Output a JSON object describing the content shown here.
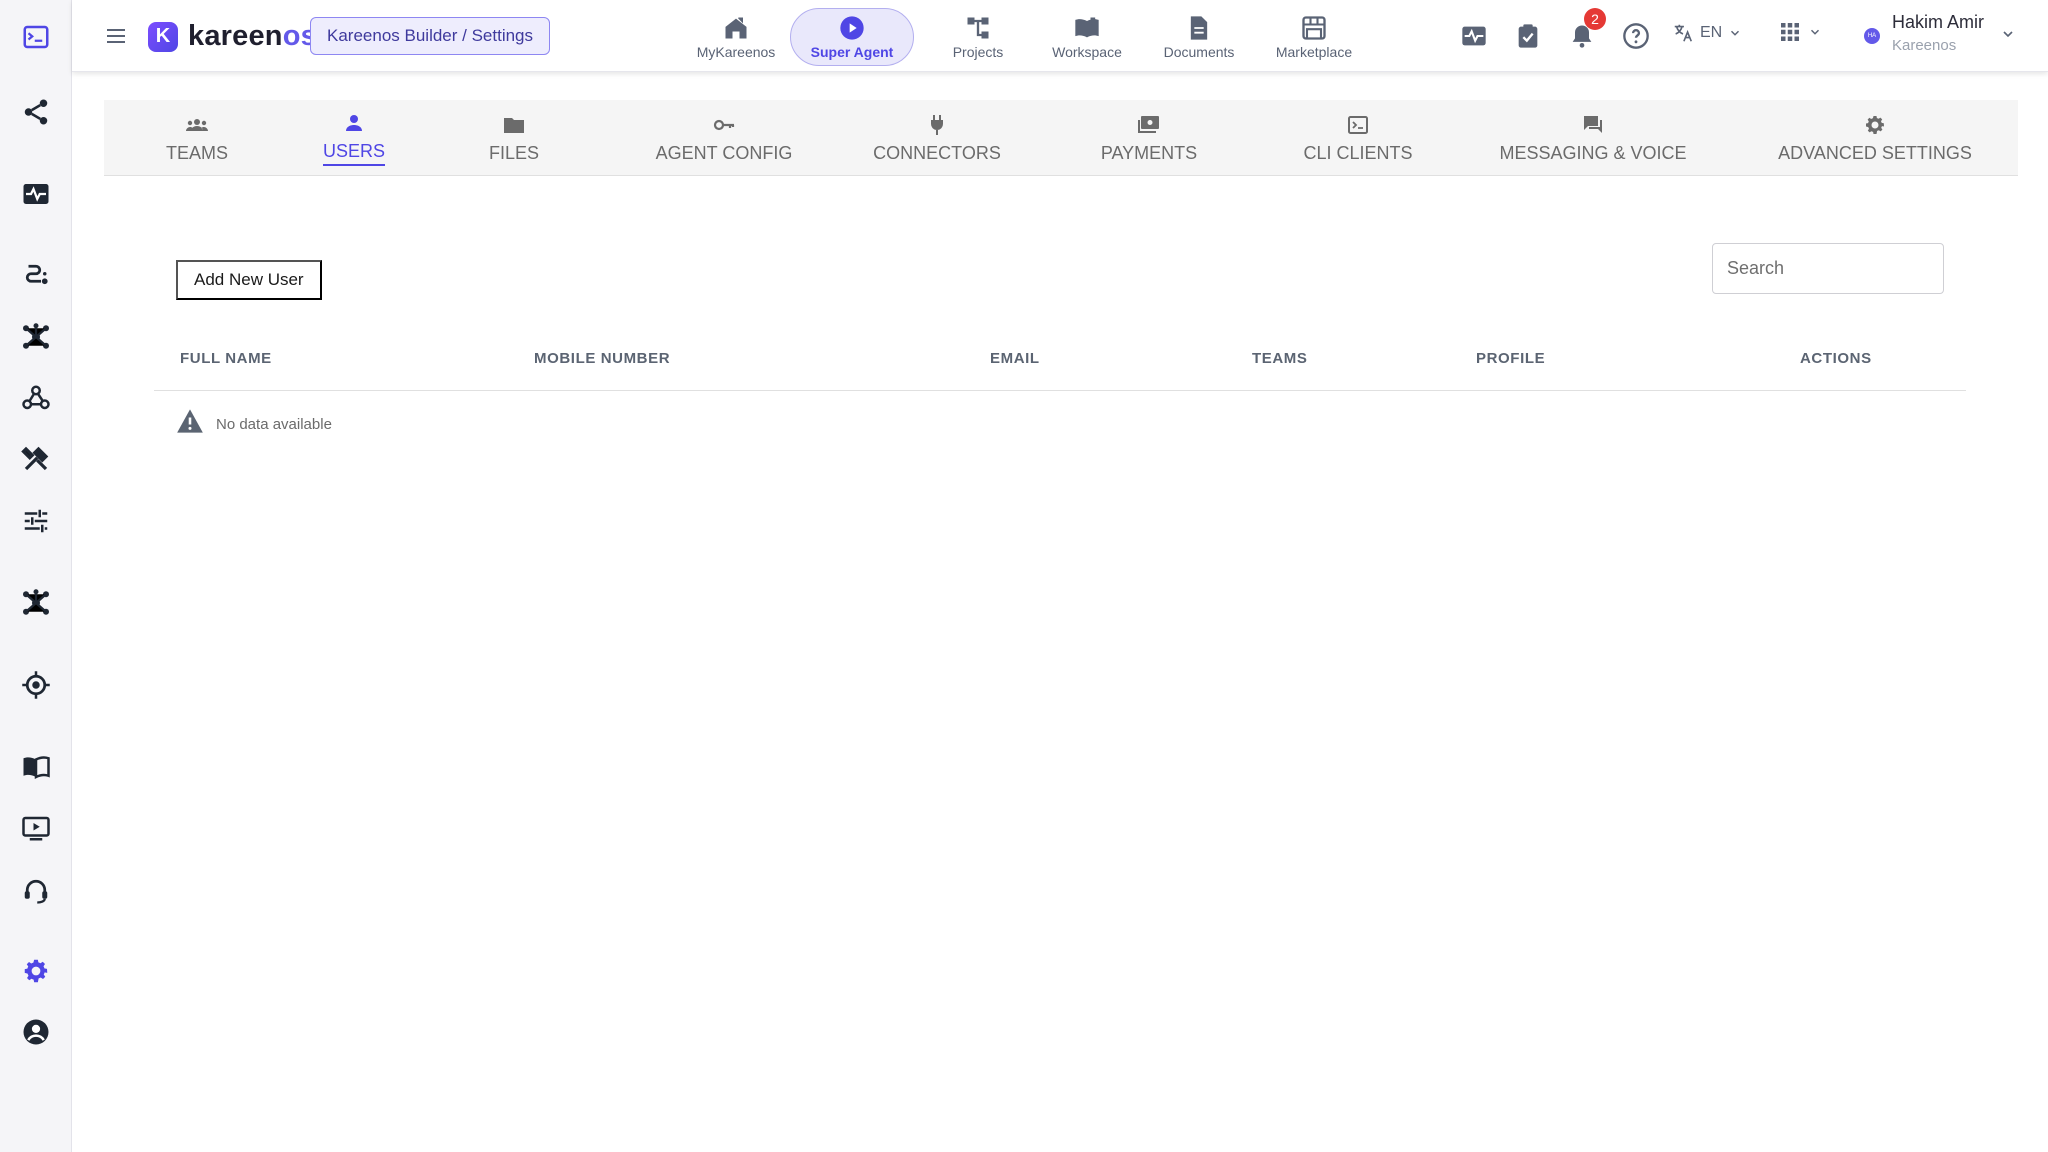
{
  "app": {
    "logo_letter": "K",
    "brand_main": "kareen",
    "brand_accent": "os",
    "breadcrumb": "Kareenos Builder / Settings",
    "accent_color": "#4f46e5"
  },
  "sidebar": {
    "items": [
      {
        "name": "console-icon"
      },
      {
        "name": "share-icon"
      },
      {
        "name": "monitor-heartbeat-icon"
      },
      {
        "name": "route-icon"
      },
      {
        "name": "hub-icon"
      },
      {
        "name": "webhook-icon"
      },
      {
        "name": "tools-icon"
      },
      {
        "name": "tune-icon"
      },
      {
        "name": "hub-icon"
      },
      {
        "name": "target-icon"
      },
      {
        "name": "book-icon"
      },
      {
        "name": "video-icon"
      },
      {
        "name": "support-agent-icon"
      },
      {
        "name": "gear-icon",
        "active": true
      },
      {
        "name": "account-circle-icon"
      }
    ]
  },
  "topnav": {
    "items": [
      {
        "label": "MyKareenos",
        "icon": "home-icon"
      },
      {
        "label": "Super Agent",
        "icon": "play-circle-icon",
        "active": true
      },
      {
        "label": "Projects",
        "icon": "hierarchy-icon"
      },
      {
        "label": "Workspace",
        "icon": "open-book-icon"
      },
      {
        "label": "Documents",
        "icon": "document-icon"
      },
      {
        "label": "Marketplace",
        "icon": "store-icon"
      }
    ]
  },
  "toolbar": {
    "notifications_count": "2",
    "language": "EN"
  },
  "user": {
    "initials": "HA",
    "name": "Hakim Amir",
    "org": "Kareenos"
  },
  "tabs": [
    {
      "label": "TEAMS",
      "icon": "groups-icon"
    },
    {
      "label": "USERS",
      "icon": "person-icon",
      "active": true
    },
    {
      "label": "FILES",
      "icon": "folder-icon"
    },
    {
      "label": "AGENT CONFIG",
      "icon": "key-icon"
    },
    {
      "label": "CONNECTORS",
      "icon": "plug-icon"
    },
    {
      "label": "PAYMENTS",
      "icon": "payments-icon"
    },
    {
      "label": "CLI CLIENTS",
      "icon": "terminal-icon"
    },
    {
      "label": "MESSAGING & VOICE",
      "icon": "chat-icon"
    },
    {
      "label": "ADVANCED SETTINGS",
      "icon": "gear-icon"
    }
  ],
  "users": {
    "add_label": "Add New User",
    "search_placeholder": "Search",
    "search_value": "",
    "columns": [
      "FULL NAME",
      "MOBILE NUMBER",
      "EMAIL",
      "TEAMS",
      "PROFILE",
      "ACTIONS"
    ],
    "rows": [],
    "empty_text": "No data available"
  }
}
